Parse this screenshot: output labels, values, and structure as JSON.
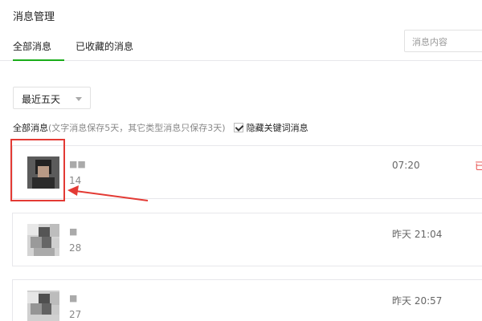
{
  "page": {
    "title": "消息管理"
  },
  "tabs": [
    {
      "label": "全部消息",
      "active": true
    },
    {
      "label": "已收藏的消息",
      "active": false
    }
  ],
  "search": {
    "placeholder": "消息内容"
  },
  "filter": {
    "range_select": {
      "value": "最近五天"
    },
    "summary_label": "全部消息",
    "summary_note": "(文字消息保存5天，其它类型消息只保存3天)",
    "hide_keyword_label": "隐藏关键词消息",
    "hide_keyword_checked": true
  },
  "messages": [
    {
      "name": "■■",
      "count": "14",
      "time": "07:20",
      "extra": "已"
    },
    {
      "name": "■",
      "count": "28",
      "time": "昨天 21:04"
    },
    {
      "name": "■",
      "count": "27",
      "time": "昨天 20:57"
    }
  ],
  "colors": {
    "accent": "#1aad19",
    "highlight": "#e33a34",
    "status_red": "#e64340"
  }
}
